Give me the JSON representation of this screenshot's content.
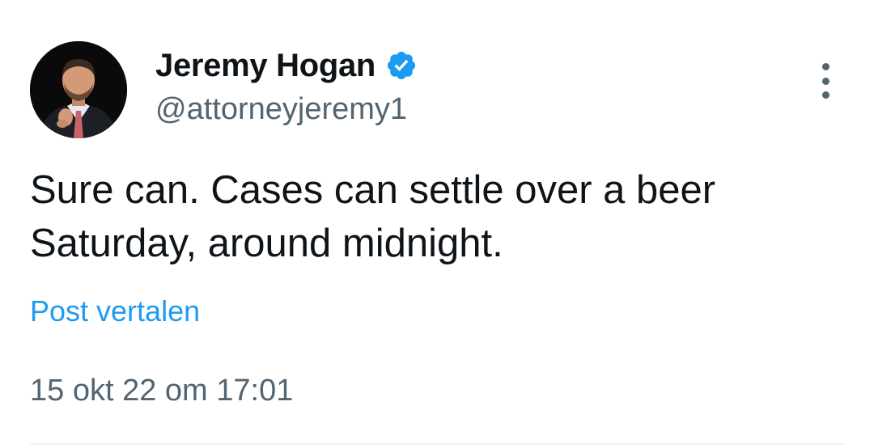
{
  "tweet": {
    "author": {
      "display_name": "Jeremy Hogan",
      "handle": "@attorneyjeremy1",
      "verified": true,
      "verified_color": "#1d9bf0"
    },
    "text_lines": [
      "Sure can. Cases can settle over a beer",
      "Saturday, around midnight."
    ],
    "translate_label": "Post vertalen",
    "timestamp": "15 okt 22 om 17:01",
    "more_icon": "more-vertical-icon"
  }
}
